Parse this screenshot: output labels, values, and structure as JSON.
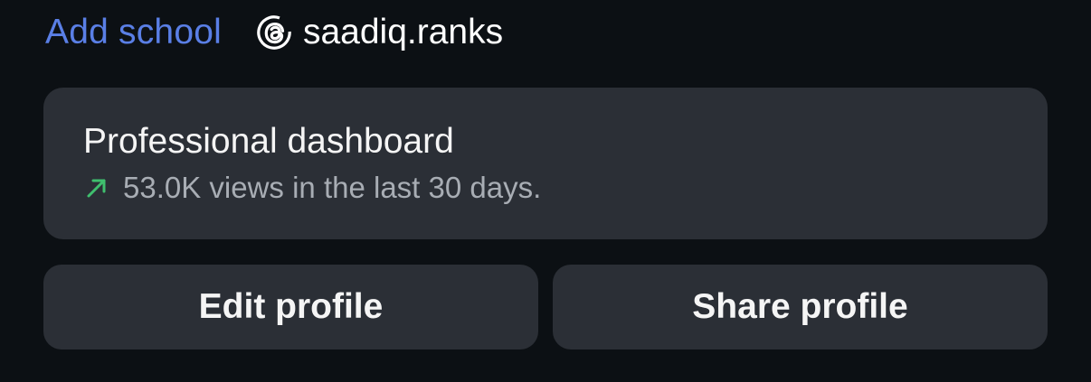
{
  "profile": {
    "add_school_label": "Add school",
    "threads_handle": "saadiq.ranks",
    "threads_icon": "threads-icon"
  },
  "dashboard": {
    "title": "Professional dashboard",
    "stat_text": "53.0K views in the last 30 days.",
    "trend_icon": "trend-up-arrow-icon",
    "trend_color": "#3fbf6e"
  },
  "actions": {
    "edit_profile_label": "Edit profile",
    "share_profile_label": "Share profile"
  },
  "colors": {
    "background": "#0c1014",
    "card": "#2b2f36",
    "link_accent": "#5a7fe6",
    "text_primary": "#f5f5f5",
    "text_secondary": "#a8adb4"
  }
}
